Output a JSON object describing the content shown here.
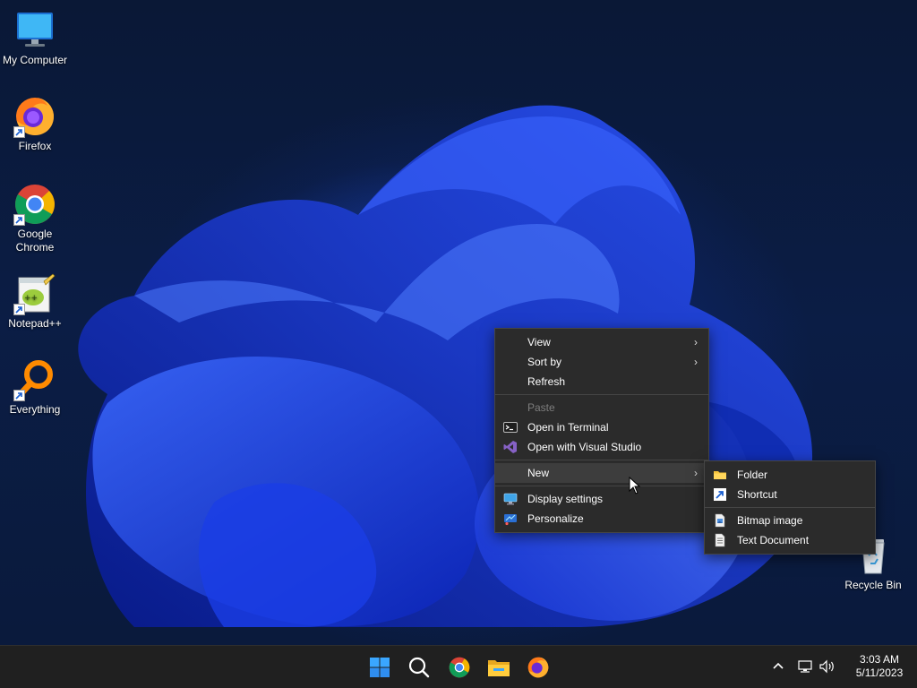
{
  "desktop_icons": [
    {
      "name": "my-computer",
      "label": "My Computer",
      "icon": "monitor-icon"
    },
    {
      "name": "firefox",
      "label": "Firefox",
      "icon": "firefox-icon"
    },
    {
      "name": "google-chrome",
      "label": "Google Chrome",
      "icon": "chrome-icon"
    },
    {
      "name": "notepadpp",
      "label": "Notepad++",
      "icon": "notepadpp-icon"
    },
    {
      "name": "everything",
      "label": "Everything",
      "icon": "magnifier-icon"
    },
    {
      "name": "recycle-bin",
      "label": "Recycle Bin",
      "icon": "recycle-bin-icon"
    }
  ],
  "context_menu": {
    "view": "View",
    "sort_by": "Sort by",
    "refresh": "Refresh",
    "paste": "Paste",
    "open_terminal": "Open in Terminal",
    "open_vs": "Open with Visual Studio",
    "new": "New",
    "display_settings": "Display settings",
    "personalize": "Personalize"
  },
  "new_submenu": {
    "folder": "Folder",
    "shortcut": "Shortcut",
    "bitmap": "Bitmap image",
    "text_document": "Text Document"
  },
  "taskbar": {
    "apps": [
      "start-icon",
      "search-icon",
      "chrome-icon",
      "file-explorer-icon",
      "firefox-icon"
    ],
    "time": "3:03 AM",
    "date": "5/11/2023"
  },
  "colors": {
    "menu_bg": "#2b2b2b",
    "taskbar_bg": "#202020",
    "accent_blue": "#1f4dff"
  }
}
